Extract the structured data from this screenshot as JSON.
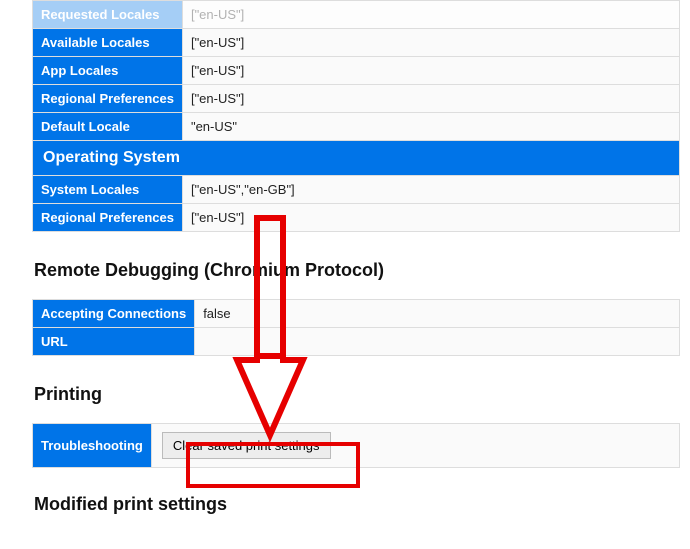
{
  "locale_table": {
    "rows": [
      {
        "label": "Requested Locales",
        "value": "[\"en-US\"]"
      },
      {
        "label": "Available Locales",
        "value": "[\"en-US\"]"
      },
      {
        "label": "App Locales",
        "value": "[\"en-US\"]"
      },
      {
        "label": "Regional Preferences",
        "value": "[\"en-US\"]"
      },
      {
        "label": "Default Locale",
        "value": "\"en-US\""
      }
    ],
    "section_header": "Operating System",
    "os_rows": [
      {
        "label": "System Locales",
        "value": "[\"en-US\",\"en-GB\"]"
      },
      {
        "label": "Regional Preferences",
        "value": "[\"en-US\"]"
      }
    ]
  },
  "remote_debugging": {
    "heading": "Remote Debugging (Chromium Protocol)",
    "rows": [
      {
        "label": "Accepting Connections",
        "value": "false"
      },
      {
        "label": "URL",
        "value": ""
      }
    ]
  },
  "printing": {
    "heading": "Printing",
    "row_label": "Troubleshooting",
    "button_label": "Clear saved print settings"
  },
  "modified_heading": "Modified print settings"
}
